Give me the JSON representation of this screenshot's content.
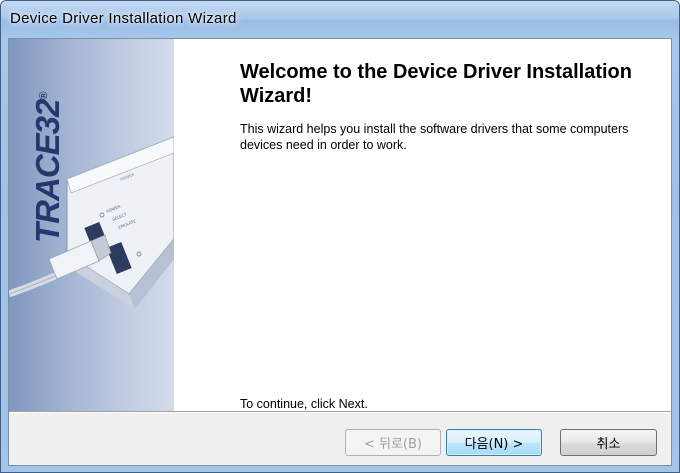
{
  "window": {
    "title": "Device Driver Installation Wizard"
  },
  "side_panel": {
    "brand": "TRACE32",
    "brand_mark": "®",
    "device_labels": {
      "power_top": "POWER",
      "power": "POWER",
      "select": "SELECT",
      "emulate": "EMULATE"
    }
  },
  "content": {
    "heading": "Welcome to the Device Driver Installation Wizard!",
    "description": "This wizard helps you install the software drivers that some computers devices need in order to work.",
    "continue_text": "To continue, click Next."
  },
  "buttons": {
    "back": "< 뒤로(B)",
    "next": "다음(N) >",
    "cancel": "취소"
  },
  "colors": {
    "title_bar": "#a9c8ea",
    "side_panel": "#9fb2d3",
    "brand": "#24386e",
    "next_button_border": "#3c7fb1"
  }
}
